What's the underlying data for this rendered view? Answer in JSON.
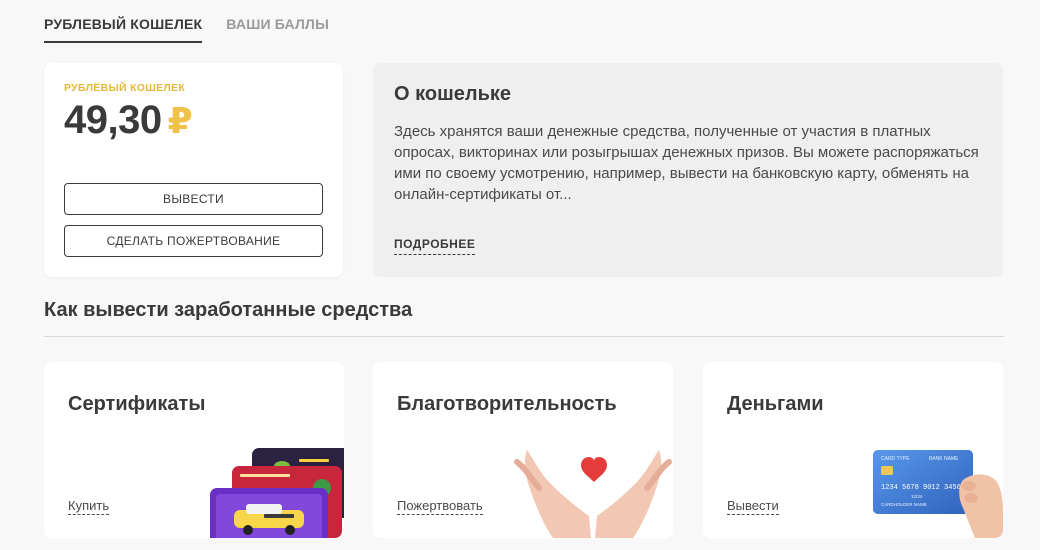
{
  "tabs": [
    {
      "label": "РУБЛЕВЫЙ КОШЕЛЕК",
      "active": true
    },
    {
      "label": "ВАШИ БАЛЛЫ",
      "active": false
    }
  ],
  "wallet": {
    "label": "РУБЛЁВЫЙ КОШЕЛЕК",
    "balance": "49,30",
    "currency": "₽",
    "withdraw_label": "ВЫВЕСТИ",
    "donate_label": "СДЕЛАТЬ ПОЖЕРТВОВАНИЕ"
  },
  "about": {
    "title": "О кошельке",
    "text": "Здесь хранятся ваши денежные средства, полученные от участия в платных опросах, викторинах или розыгрышах денежных призов. Вы можете распоряжаться ими по своему усмотрению, например, вывести на банковскую карту, обменять на онлайн-сертификаты от...",
    "more_label": "ПОДРОБНЕЕ"
  },
  "section": {
    "title": "Как вывести заработанные средства"
  },
  "options": {
    "certificates": {
      "title": "Сертификаты",
      "link": "Купить"
    },
    "charity": {
      "title": "Благотворительность",
      "link": "Пожертвовать"
    },
    "money": {
      "title": "Деньгами",
      "link": "Вывести"
    }
  },
  "bank_card": {
    "type_label": "CARD TYPE",
    "bank_label": "BANK NAME",
    "number": "1234 5678 9012 3456",
    "holder": "CARDHOLDER NAME",
    "expiry": "12/34"
  },
  "colors": {
    "accent_yellow": "#f0c24a",
    "text_dark": "#3a3a3a",
    "about_bg": "#efeff0",
    "heart_red": "#e63b3b",
    "card_blue": "#3f7fd6"
  },
  "icons": {
    "currency": "ruble-sign",
    "heart": "heart-icon"
  }
}
